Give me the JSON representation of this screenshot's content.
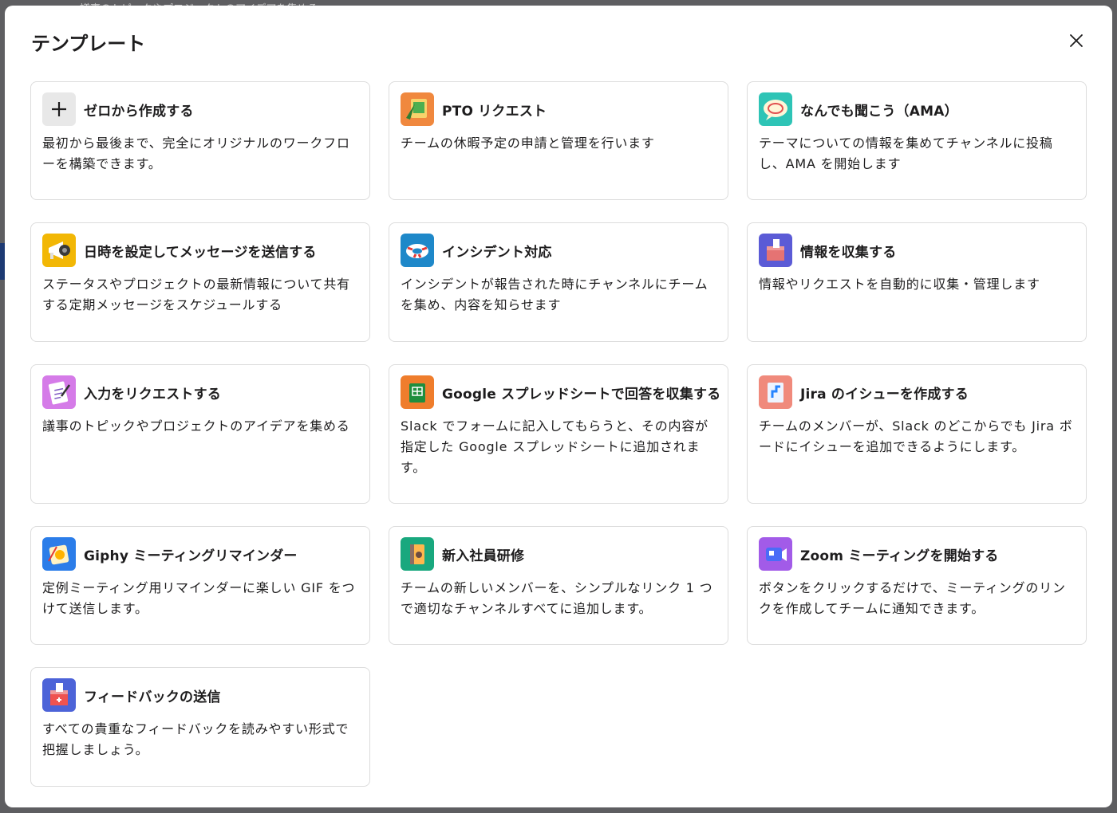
{
  "background": {
    "peek_text": "議事のトピックやプロジェクトのアイデアを集める"
  },
  "modal": {
    "title": "テンプレート",
    "close_icon": "close-icon"
  },
  "colors": {
    "zero": "#e8e8e8",
    "pto": "#f0883e",
    "ama": "#2ec4b6",
    "schedule": "#f2b705",
    "incident": "#1e88c9",
    "collect": "#5b5bd6",
    "request": "#d57be8",
    "sheets": "#ef7d2c",
    "jira": "#f08a7c",
    "giphy": "#2b7de9",
    "onboarding": "#19a87e",
    "zoom": "#a25be8",
    "feedback": "#4c63d8"
  },
  "templates": [
    {
      "key": "zero",
      "icon": "plus-icon",
      "title": "ゼロから作成する",
      "desc": "最初から最後まで、完全にオリジナルのワークフローを構築できます。"
    },
    {
      "key": "pto",
      "icon": "vacation-calendar-icon",
      "title": "PTO リクエスト",
      "desc": "チームの休暇予定の申請と管理を行います"
    },
    {
      "key": "ama",
      "icon": "speech-bubble-icon",
      "title": "なんでも聞こう（AMA）",
      "desc": "テーマについての情報を集めてチャンネルに投稿し、AMA を開始します"
    },
    {
      "key": "schedule",
      "icon": "megaphone-icon",
      "title": "日時を設定してメッセージを送信する",
      "desc": "ステータスやプロジェクトの最新情報について共有する定期メッセージをスケジュールする"
    },
    {
      "key": "incident",
      "icon": "lifebuoy-icon",
      "title": "インシデント対応",
      "desc": "インシデントが報告された時にチャンネルにチームを集め、内容を知らせます"
    },
    {
      "key": "collect",
      "icon": "ballot-box-icon",
      "title": "情報を収集する",
      "desc": "情報やリクエストを自動的に収集・管理します"
    },
    {
      "key": "request",
      "icon": "clipboard-icon",
      "title": "入力をリクエストする",
      "desc": "議事のトピックやプロジェクトのアイデアを集める"
    },
    {
      "key": "sheets",
      "icon": "spreadsheet-icon",
      "title": "Google スプレッドシートで回答を収集する",
      "desc": "Slack でフォームに記入してもらうと、その内容が指定した Google スプレッドシートに追加されます。"
    },
    {
      "key": "jira",
      "icon": "jira-board-icon",
      "title": "Jira のイシューを作成する",
      "desc": "チームのメンバーが、Slack のどこからでも Jira ボードにイシューを追加できるようにします。"
    },
    {
      "key": "giphy",
      "icon": "calendar-gif-icon",
      "title": "Giphy ミーティングリマインダー",
      "desc": "定例ミーティング用リマインダーに楽しい GIF をつけて送信します。"
    },
    {
      "key": "onboarding",
      "icon": "welcome-book-icon",
      "title": "新入社員研修",
      "desc": "チームの新しいメンバーを、シンプルなリンク 1 つで適切なチャンネルすべてに追加します。"
    },
    {
      "key": "zoom",
      "icon": "video-camera-icon",
      "title": "Zoom ミーティングを開始する",
      "desc": "ボタンをクリックするだけで、ミーティングのリンクを作成してチームに通知できます。"
    },
    {
      "key": "feedback",
      "icon": "feedback-box-icon",
      "title": "フィードバックの送信",
      "desc": "すべての貴重なフィードバックを読みやすい形式で把握しましょう。"
    }
  ]
}
